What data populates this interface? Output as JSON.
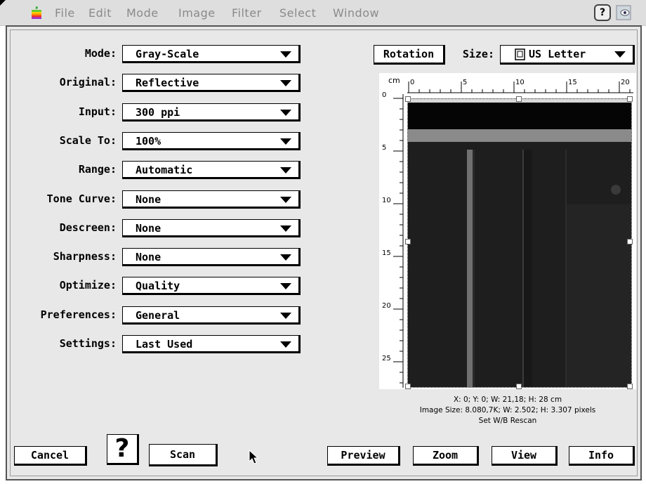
{
  "menubar": {
    "items": [
      "File",
      "Edit",
      "Mode",
      "Image",
      "Filter",
      "Select",
      "Window"
    ],
    "help_icon": "question-mark-icon",
    "right_icon": "eye-icon"
  },
  "settings": [
    {
      "label": "Mode:",
      "value": "Gray-Scale"
    },
    {
      "label": "Original:",
      "value": "Reflective"
    },
    {
      "label": "Input:",
      "value": "300 ppi"
    },
    {
      "label": "Scale To:",
      "value": "100%"
    },
    {
      "label": "Range:",
      "value": "Automatic"
    },
    {
      "label": "Tone Curve:",
      "value": "None"
    },
    {
      "label": "Descreen:",
      "value": "None"
    },
    {
      "label": "Sharpness:",
      "value": "None"
    },
    {
      "label": "Optimize:",
      "value": "Quality"
    },
    {
      "label": "Preferences:",
      "value": "General"
    },
    {
      "label": "Settings:",
      "value": "Last Used"
    }
  ],
  "preview": {
    "rotation_label": "Rotation",
    "size_label": "Size:",
    "size_value": "US Letter",
    "unit": "cm",
    "ruler_top": [
      "0",
      "5",
      "10",
      "15",
      "20"
    ],
    "ruler_left": [
      "0",
      "5",
      "10",
      "15",
      "20",
      "25"
    ]
  },
  "info": {
    "line1": "X: 0; Y: 0; W: 21,18; H: 28  cm",
    "line2": "Image Size: 8.080,7K; W: 2.502; H: 3.307  pixels",
    "line3": "Set W/B Rescan"
  },
  "buttons": {
    "cancel": "Cancel",
    "help": "?",
    "scan": "Scan",
    "preview": "Preview",
    "zoom": "Zoom",
    "view": "View",
    "info": "Info"
  },
  "colors": {
    "window_bg": "#e8e8e8",
    "menubar_text": "#8a8a8a",
    "preview_dark": "#121212"
  }
}
